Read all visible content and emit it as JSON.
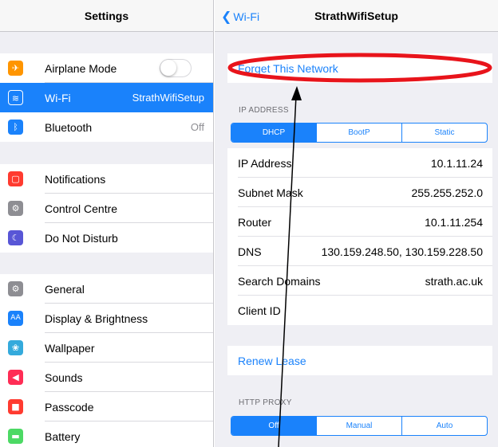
{
  "left": {
    "title": "Settings",
    "rows": [
      {
        "label": "Airplane Mode",
        "icon": "airplane-icon",
        "icon_color": "#ff9500",
        "toggle": false
      },
      {
        "label": "Wi-Fi",
        "icon": "wifi-icon",
        "icon_color": "#1a82fb",
        "value": "StrathWifiSetup",
        "selected": true
      },
      {
        "label": "Bluetooth",
        "icon": "bluetooth-icon",
        "icon_color": "#1a82fb",
        "value": "Off"
      },
      {
        "label": "Notifications",
        "icon": "notifications-icon",
        "icon_color": "#ff3b30"
      },
      {
        "label": "Control Centre",
        "icon": "control-centre-icon",
        "icon_color": "#8e8e93"
      },
      {
        "label": "Do Not Disturb",
        "icon": "moon-icon",
        "icon_color": "#5856d6"
      },
      {
        "label": "General",
        "icon": "gear-icon",
        "icon_color": "#8e8e93"
      },
      {
        "label": "Display & Brightness",
        "icon": "text-size-icon",
        "icon_color": "#1a82fb",
        "icon_text": "AA"
      },
      {
        "label": "Wallpaper",
        "icon": "wallpaper-icon",
        "icon_color": "#34aadc"
      },
      {
        "label": "Sounds",
        "icon": "speaker-icon",
        "icon_color": "#ff2d55"
      },
      {
        "label": "Passcode",
        "icon": "lock-icon",
        "icon_color": "#ff3b30"
      },
      {
        "label": "Battery",
        "icon": "battery-icon",
        "icon_color": "#4cd964"
      }
    ]
  },
  "right": {
    "back_label": "Wi-Fi",
    "title": "StrathWifiSetup",
    "forget": "Forget This Network",
    "ip_section": "IP ADDRESS",
    "ip_modes": [
      "DHCP",
      "BootP",
      "Static"
    ],
    "ip_mode_selected": "DHCP",
    "ip_rows": [
      {
        "key": "IP Address",
        "value": "10.1.11.24"
      },
      {
        "key": "Subnet Mask",
        "value": "255.255.252.0"
      },
      {
        "key": "Router",
        "value": "10.1.11.254"
      },
      {
        "key": "DNS",
        "value": "130.159.248.50, 130.159.228.50"
      },
      {
        "key": "Search Domains",
        "value": "strath.ac.uk"
      },
      {
        "key": "Client ID",
        "value": ""
      }
    ],
    "renew": "Renew Lease",
    "proxy_section": "HTTP PROXY",
    "proxy_modes": [
      "Off",
      "Manual",
      "Auto"
    ],
    "proxy_mode_selected": "Off"
  },
  "annotation": {
    "highlight_color": "#e8141b",
    "arrow_color": "#000000"
  }
}
